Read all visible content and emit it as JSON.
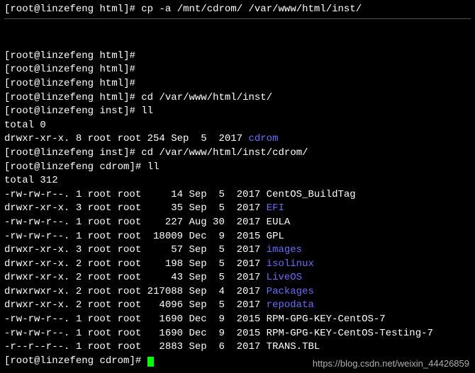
{
  "prompt": {
    "user": "root",
    "host": "linzefeng",
    "sep_open": "[",
    "sep_close": "]# ",
    "at": "@",
    "sp": " "
  },
  "lines": {
    "l1_dir": "html",
    "l1_cmd": "cp -a /mnt/cdrom/ /var/www/html/inst/",
    "blank": "",
    "l2_dir": "html",
    "l2_cmd": "",
    "l3_dir": "html",
    "l3_cmd": "",
    "l4_dir": "html",
    "l4_cmd": "",
    "l5_dir": "html",
    "l5_cmd": "cd /var/www/html/inst/",
    "l6_dir": "inst",
    "l6_cmd": "ll",
    "l7_total": "total 0",
    "l8_perm": "drwxr-xr-x. 8 root root 254 Sep  5  2017 ",
    "l8_name": "cdrom",
    "l9_dir": "inst",
    "l9_cmd": "cd /var/www/html/inst/cdrom/",
    "l10_dir": "cdrom",
    "l10_cmd": "ll",
    "l11_total": "total 312"
  },
  "listing": [
    {
      "perm": "-rw-rw-r--. 1 root root     14 Sep  5  2017 ",
      "name": "CentOS_BuildTag",
      "is_dir": false
    },
    {
      "perm": "drwxr-xr-x. 3 root root     35 Sep  5  2017 ",
      "name": "EFI",
      "is_dir": true
    },
    {
      "perm": "-rw-rw-r--. 1 root root    227 Aug 30  2017 ",
      "name": "EULA",
      "is_dir": false
    },
    {
      "perm": "-rw-rw-r--. 1 root root  18009 Dec  9  2015 ",
      "name": "GPL",
      "is_dir": false
    },
    {
      "perm": "drwxr-xr-x. 3 root root     57 Sep  5  2017 ",
      "name": "images",
      "is_dir": true
    },
    {
      "perm": "drwxr-xr-x. 2 root root    198 Sep  5  2017 ",
      "name": "isolinux",
      "is_dir": true
    },
    {
      "perm": "drwxr-xr-x. 2 root root     43 Sep  5  2017 ",
      "name": "LiveOS",
      "is_dir": true
    },
    {
      "perm": "drwxrwxr-x. 2 root root 217088 Sep  4  2017 ",
      "name": "Packages",
      "is_dir": true
    },
    {
      "perm": "drwxr-xr-x. 2 root root   4096 Sep  5  2017 ",
      "name": "repodata",
      "is_dir": true
    },
    {
      "perm": "-rw-rw-r--. 1 root root   1690 Dec  9  2015 ",
      "name": "RPM-GPG-KEY-CentOS-7",
      "is_dir": false
    },
    {
      "perm": "-rw-rw-r--. 1 root root   1690 Dec  9  2015 ",
      "name": "RPM-GPG-KEY-CentOS-Testing-7",
      "is_dir": false
    },
    {
      "perm": "-r--r--r--. 1 root root   2883 Sep  6  2017 ",
      "name": "TRANS.TBL",
      "is_dir": false
    }
  ],
  "final_prompt_dir": "cdrom",
  "watermark": "https://blog.csdn.net/weixin_44426859"
}
